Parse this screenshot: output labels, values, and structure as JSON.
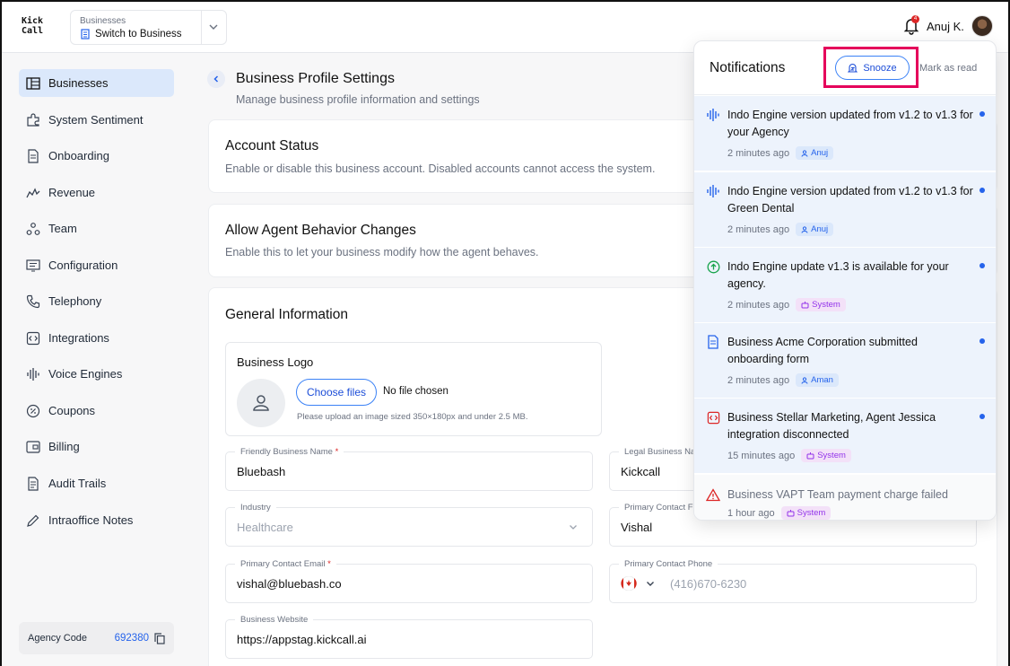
{
  "brand": {
    "line1": "Kick",
    "line2": "Call"
  },
  "business_switcher": {
    "label": "Businesses",
    "value": "Switch to Business"
  },
  "header": {
    "notification_count": "4",
    "user_name": "Anuj K."
  },
  "sidebar": {
    "items": [
      {
        "label": "Businesses",
        "icon": "table-icon",
        "active": true
      },
      {
        "label": "System Sentiment",
        "icon": "puzzle-icon"
      },
      {
        "label": "Onboarding",
        "icon": "document-icon"
      },
      {
        "label": "Revenue",
        "icon": "trend-icon"
      },
      {
        "label": "Team",
        "icon": "team-icon"
      },
      {
        "label": "Configuration",
        "icon": "config-icon"
      },
      {
        "label": "Telephony",
        "icon": "phone-icon"
      },
      {
        "label": "Integrations",
        "icon": "code-icon"
      },
      {
        "label": "Voice Engines",
        "icon": "waveform-icon"
      },
      {
        "label": "Coupons",
        "icon": "coupon-icon"
      },
      {
        "label": "Billing",
        "icon": "billing-icon"
      },
      {
        "label": "Audit Trails",
        "icon": "audit-icon"
      },
      {
        "label": "Intraoffice Notes",
        "icon": "pencil-icon"
      }
    ],
    "agency_label": "Agency Code",
    "agency_code": "692380"
  },
  "page": {
    "title": "Business Profile Settings",
    "subtitle": "Manage business profile information and settings"
  },
  "account_status": {
    "title": "Account Status",
    "description": "Enable or disable this business account. Disabled accounts cannot access the system."
  },
  "agent_behavior": {
    "title": "Allow Agent Behavior Changes",
    "description": "Enable this to let your business modify how the agent behaves."
  },
  "general": {
    "title": "General Information",
    "logo_title": "Business Logo",
    "choose_label": "Choose files",
    "no_file": "No file chosen",
    "upload_hint": "Please upload an image sized 350×180px and under 2.5 MB.",
    "friendly_name_label": "Friendly Business Name",
    "friendly_name": "Bluebash",
    "legal_name_label": "Legal Business Na",
    "legal_name": "Kickcall",
    "industry_label": "Industry",
    "industry": "Healthcare",
    "primary_first_label": "Primary Contact F",
    "primary_first": "Vishal",
    "email_label": "Primary Contact Email",
    "email": "vishal@bluebash.co",
    "phone_label": "Primary Contact Phone",
    "phone": "(416)670-6230",
    "website_label": "Business Website",
    "website": "https://appstag.kickcall.ai"
  },
  "notifications": {
    "title": "Notifications",
    "snooze_label": "Snooze",
    "mark_read_label": "Mark as read",
    "items": [
      {
        "text": "Indo Engine version updated from v1.2 to v1.3 for your Agency",
        "time": "2 minutes ago",
        "tag": "Anuj",
        "tag_type": "user",
        "icon": "waveform-icon",
        "unread": true
      },
      {
        "text": "Indo Engine version updated from v1.2 to v1.3 for Green Dental",
        "time": "2 minutes ago",
        "tag": "Anuj",
        "tag_type": "user",
        "icon": "waveform-icon",
        "unread": true
      },
      {
        "text": "Indo Engine update v1.3 is available for your agency.",
        "time": "2 minutes ago",
        "tag": "System",
        "tag_type": "system",
        "icon": "arrow-up-circle-icon",
        "unread": true
      },
      {
        "text": "Business Acme Corporation submitted onboarding form",
        "time": "2 minutes ago",
        "tag": "Aman",
        "tag_type": "user",
        "icon": "document-icon",
        "unread": true
      },
      {
        "text": "Business Stellar Marketing, Agent Jessica integration disconnected",
        "time": "15 minutes ago",
        "tag": "System",
        "tag_type": "system",
        "icon": "code-icon",
        "unread": true
      },
      {
        "text": "Business VAPT Team payment charge failed",
        "time": "1 hour ago",
        "tag": "System",
        "tag_type": "system",
        "icon": "warning-icon",
        "unread": false
      }
    ]
  },
  "colors": {
    "accent": "#2563eb",
    "highlight": "#e5005b",
    "unread_bg": "#edf3fc"
  }
}
